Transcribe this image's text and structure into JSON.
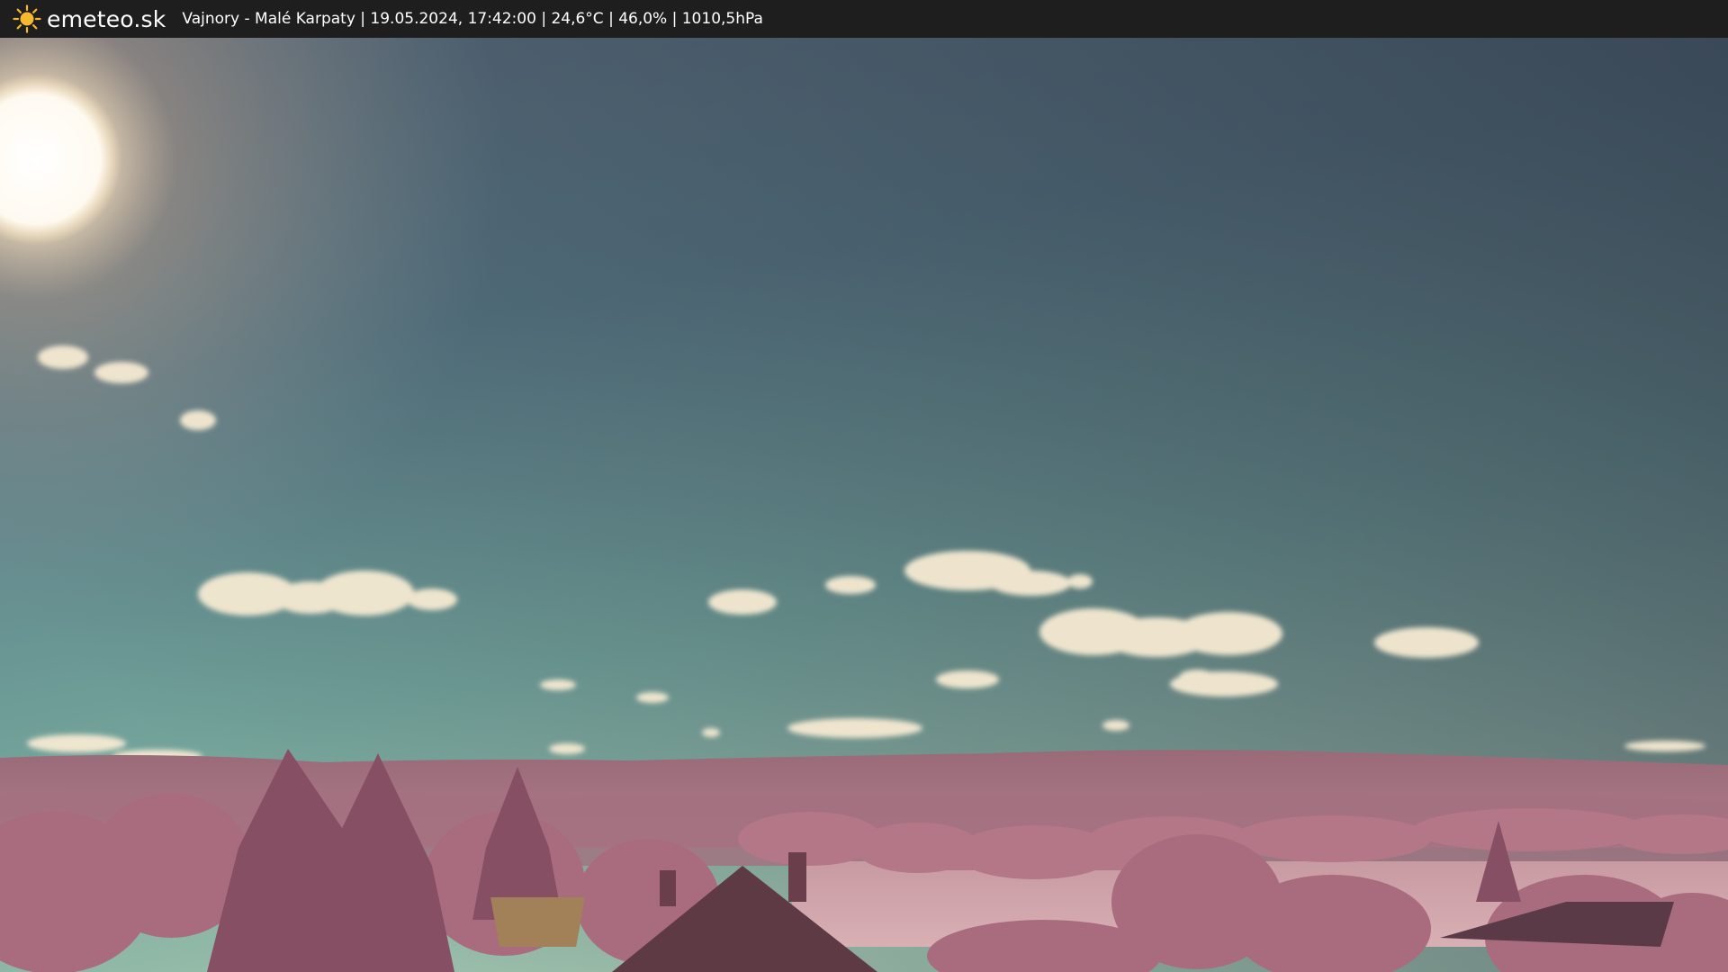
{
  "header": {
    "brand": "emeteo.sk",
    "logo_icon": "sun-icon",
    "info_text": "Vajnory - Malé Karpaty | 19.05.2024, 17:42:00 | 24,6°C | 46,0% | 1010,5hPa"
  },
  "colors": {
    "bar_background": "#1e1e1e",
    "logo_sun": "#f5b82e",
    "text": "#ffffff",
    "sky_top": "#3b4a5c",
    "sky_horizon": "#8fb7a8",
    "foliage": "#b97a8e"
  }
}
